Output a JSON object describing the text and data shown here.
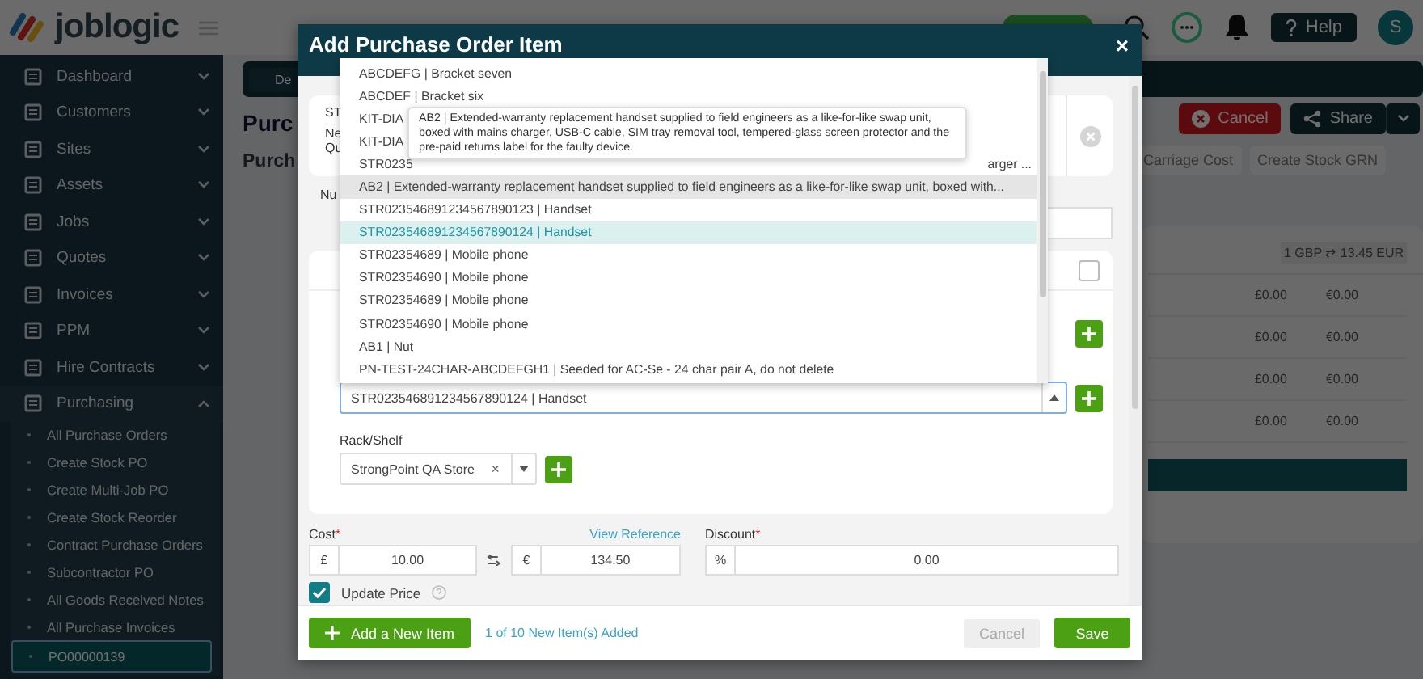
{
  "header": {
    "logo": "joblogic",
    "help": "Help",
    "avatar": "S"
  },
  "sidebar": {
    "items": [
      {
        "label": "Dashboard",
        "expanded": false
      },
      {
        "label": "Customers",
        "expanded": false
      },
      {
        "label": "Sites",
        "expanded": false
      },
      {
        "label": "Assets",
        "expanded": false
      },
      {
        "label": "Jobs",
        "expanded": false
      },
      {
        "label": "Quotes",
        "expanded": false
      },
      {
        "label": "Invoices",
        "expanded": false
      },
      {
        "label": "PPM",
        "expanded": false
      },
      {
        "label": "Hire Contracts",
        "expanded": false
      },
      {
        "label": "Purchasing",
        "expanded": true,
        "children": [
          {
            "label": "All Purchase Orders",
            "selected": false
          },
          {
            "label": "Create Stock PO",
            "selected": false
          },
          {
            "label": "Create Multi-Job PO",
            "selected": false
          },
          {
            "label": "Create Stock Reorder",
            "selected": false
          },
          {
            "label": "Contract Purchase Orders",
            "selected": false
          },
          {
            "label": "Subcontractor PO",
            "selected": false
          },
          {
            "label": "All Goods Received Notes",
            "selected": false
          },
          {
            "label": "All Purchase Invoices",
            "selected": false
          },
          {
            "label": "PO00000139",
            "selected": true
          }
        ]
      }
    ]
  },
  "page": {
    "breadcrumb": "De",
    "title": "Purc",
    "subtitle": "Purch",
    "actions": [
      {
        "label": "Cancel",
        "kind": "danger"
      },
      {
        "label": "Share",
        "kind": "dark"
      }
    ],
    "secondary_actions": [
      "Carriage Cost",
      "Create Stock GRN"
    ],
    "rate": "1 GBP ⇄ 13.45 EUR",
    "totals": [
      [
        "£0.00",
        "€0.00"
      ],
      [
        "£0.00",
        "€0.00"
      ],
      [
        "£0.00",
        "€0.00"
      ],
      [
        "£0.00",
        "€0.00"
      ]
    ]
  },
  "modal": {
    "title": "Add Purchase Order Item",
    "close": "×",
    "fragments": [
      "ST",
      "Ne",
      "Qu",
      "Nu"
    ],
    "row_checkbox": {
      "checked": false
    },
    "options": [
      {
        "text": "ABCDEFG | Bracket seven",
        "selected": false,
        "hovered": false
      },
      {
        "text": "ABCDEF | Bracket six",
        "selected": false,
        "hovered": false
      },
      {
        "text": "KIT-DIA",
        "selected": false,
        "hovered": false
      },
      {
        "text": "KIT-DIA",
        "selected": false,
        "hovered": false
      },
      {
        "text": "STR0235",
        "tail": "arger ...",
        "selected": false,
        "hovered": false
      },
      {
        "text": "AB2 | Extended-warranty replacement handset supplied to field engineers as a like-for-like swap unit, boxed with...",
        "selected": false,
        "hovered": true
      },
      {
        "text": "STR023546891234567890123 | Handset",
        "selected": false,
        "hovered": false
      },
      {
        "text": "STR023546891234567890124 | Handset",
        "selected": true,
        "hovered": false
      },
      {
        "text": "STR02354689 | Mobile phone",
        "selected": false,
        "hovered": false
      },
      {
        "text": "STR02354690 | Mobile phone",
        "selected": false,
        "hovered": false
      },
      {
        "text": "STR02354689 | Mobile phone",
        "selected": false,
        "hovered": false
      },
      {
        "text": "STR02354690 | Mobile phone",
        "selected": false,
        "hovered": false
      },
      {
        "text": "AB1 | Nut",
        "selected": false,
        "hovered": false
      },
      {
        "text": "PN-TEST-24CHAR-ABCDEFGH1 | Seeded for AC-Se - 24 char pair A, do not delete",
        "selected": false,
        "hovered": false
      }
    ],
    "tooltip": "AB2 | Extended-warranty replacement handset supplied to field engineers as a like-for-like swap unit, boxed with mains charger, USB-C cable, SIM tray removal tool, tempered-glass screen protector and the pre-paid returns label for the faulty device.",
    "item_value": "STR023546891234567890124 | Handset",
    "rack_label": "Rack/Shelf",
    "rack_value": "StrongPoint QA Store",
    "rack_clear": "×",
    "cost_label": {
      "text": "Cost",
      "mark": "*"
    },
    "view_reference": "View Reference",
    "discount_label": {
      "text": "Discount",
      "mark": "*"
    },
    "cost_symbol": "£",
    "cost": "10.00",
    "converted_symbol": "€",
    "converted": "134.50",
    "discount_symbol": "%",
    "discount": "0.00",
    "update_price": {
      "label": "Update Price",
      "checked": true
    },
    "add_button": "Add a New Item",
    "counter": "1 of 10 New Item(s) Added",
    "cancel": {
      "label": "Cancel",
      "disabled": true
    },
    "save": "Save"
  }
}
